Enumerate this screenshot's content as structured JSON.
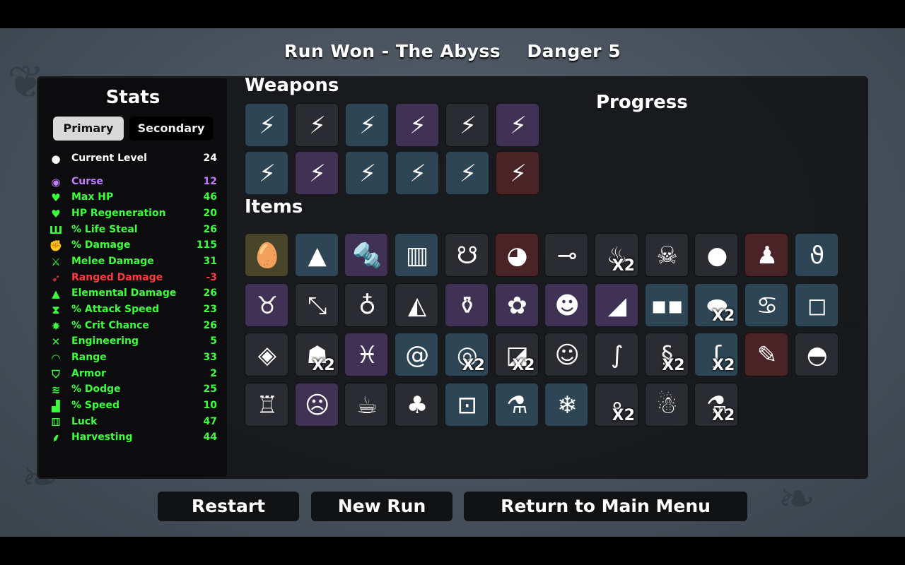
{
  "header": {
    "run_result": "Run Won - The Abyss",
    "danger": "Danger 5"
  },
  "stats": {
    "title": "Stats",
    "tabs": {
      "primary": "Primary",
      "secondary": "Secondary"
    },
    "rows": [
      {
        "label": "Current Level",
        "value": "24",
        "icon": "level-icon",
        "glyph": "●",
        "color": "#ffffff"
      },
      {
        "label": "Curse",
        "value": "12",
        "icon": "curse-icon",
        "glyph": "◉",
        "color": "#c77dff"
      },
      {
        "label": "Max HP",
        "value": "46",
        "icon": "heart-icon",
        "glyph": "♥",
        "color": "#3cff3c"
      },
      {
        "label": "HP Regeneration",
        "value": "20",
        "icon": "heart-plus-icon",
        "glyph": "♥",
        "color": "#3cff3c"
      },
      {
        "label": "% Life Steal",
        "value": "26",
        "icon": "life-steal-icon",
        "glyph": "Ш",
        "color": "#3cff3c"
      },
      {
        "label": "% Damage",
        "value": "115",
        "icon": "damage-icon",
        "glyph": "✊",
        "color": "#3cff3c"
      },
      {
        "label": "Melee Damage",
        "value": "31",
        "icon": "sword-icon",
        "glyph": "⚔",
        "color": "#3cff3c"
      },
      {
        "label": "Ranged Damage",
        "value": "-3",
        "icon": "ranged-icon",
        "glyph": "➶",
        "color": "#ff3b3b"
      },
      {
        "label": "Elemental Damage",
        "value": "26",
        "icon": "fire-icon",
        "glyph": "▲",
        "color": "#3cff3c"
      },
      {
        "label": "% Attack Speed",
        "value": "23",
        "icon": "hourglass-icon",
        "glyph": "⧗",
        "color": "#3cff3c"
      },
      {
        "label": "% Crit Chance",
        "value": "26",
        "icon": "crit-icon",
        "glyph": "✸",
        "color": "#3cff3c"
      },
      {
        "label": "Engineering",
        "value": "5",
        "icon": "wrench-icon",
        "glyph": "✕",
        "color": "#3cff3c"
      },
      {
        "label": "Range",
        "value": "33",
        "icon": "range-icon",
        "glyph": "◠",
        "color": "#3cff3c"
      },
      {
        "label": "Armor",
        "value": "2",
        "icon": "shield-icon",
        "glyph": "⛉",
        "color": "#3cff3c"
      },
      {
        "label": "% Dodge",
        "value": "25",
        "icon": "dodge-icon",
        "glyph": "≋",
        "color": "#3cff3c"
      },
      {
        "label": "% Speed",
        "value": "10",
        "icon": "boot-icon",
        "glyph": "▟",
        "color": "#3cff3c"
      },
      {
        "label": "Luck",
        "value": "47",
        "icon": "dice-icon",
        "glyph": "⚅",
        "color": "#3cff3c"
      },
      {
        "label": "Harvesting",
        "value": "44",
        "icon": "wheat-icon",
        "glyph": "⸙",
        "color": "#3cff3c"
      }
    ]
  },
  "weapons": {
    "title": "Weapons",
    "slots": [
      {
        "tier": "t2",
        "icon": "lightning-shiv-icon",
        "glyph": "⚡"
      },
      {
        "tier": "t1",
        "icon": "lightning-shiv-icon",
        "glyph": "⚡"
      },
      {
        "tier": "t2",
        "icon": "lightning-shiv-icon",
        "glyph": "⚡"
      },
      {
        "tier": "t3",
        "icon": "lightning-shiv-icon",
        "glyph": "⚡"
      },
      {
        "tier": "t1",
        "icon": "lightning-shiv-icon",
        "glyph": "⚡"
      },
      {
        "tier": "t3",
        "icon": "lightning-shiv-icon",
        "glyph": "⚡"
      },
      {
        "tier": "t2",
        "icon": "lightning-shiv-icon",
        "glyph": "⚡"
      },
      {
        "tier": "t3",
        "icon": "lightning-shiv-icon",
        "glyph": "⚡"
      },
      {
        "tier": "t2",
        "icon": "lightning-shiv-icon",
        "glyph": "⚡"
      },
      {
        "tier": "t2",
        "icon": "lightning-shiv-icon",
        "glyph": "⚡"
      },
      {
        "tier": "t2",
        "icon": "lightning-shiv-icon",
        "glyph": "⚡"
      },
      {
        "tier": "t4",
        "icon": "lightning-shiv-icon",
        "glyph": "⚡"
      }
    ]
  },
  "progress": {
    "title": "Progress"
  },
  "items": {
    "title": "Items",
    "slots": [
      {
        "tier": "t0",
        "icon": "egg-icon",
        "glyph": "🥚",
        "qty": ""
      },
      {
        "tier": "t2",
        "icon": "bullet-icon",
        "glyph": "▲",
        "qty": ""
      },
      {
        "tier": "t3",
        "icon": "screw-icon",
        "glyph": "🔩",
        "qty": ""
      },
      {
        "tier": "t2",
        "icon": "armor-plate-icon",
        "glyph": "▥",
        "qty": ""
      },
      {
        "tier": "t1",
        "icon": "alien-symbol-icon",
        "glyph": "☋",
        "qty": ""
      },
      {
        "tier": "t4",
        "icon": "alien-eye-icon",
        "glyph": "◕",
        "qty": ""
      },
      {
        "tier": "t1",
        "icon": "scope-icon",
        "glyph": "⊸",
        "qty": ""
      },
      {
        "tier": "t1",
        "icon": "worm-icon",
        "glyph": "♨",
        "qty": "X2"
      },
      {
        "tier": "t1",
        "icon": "skull-icon",
        "glyph": "☠",
        "qty": ""
      },
      {
        "tier": "t1",
        "icon": "boxing-glove-icon",
        "glyph": "●",
        "qty": ""
      },
      {
        "tier": "t4",
        "icon": "gnome-icon",
        "glyph": "♟",
        "qty": ""
      },
      {
        "tier": "t2",
        "icon": "tentacle-icon",
        "glyph": "ϑ",
        "qty": ""
      },
      {
        "tier": "t3",
        "icon": "demon-icon",
        "glyph": "♉",
        "qty": ""
      },
      {
        "tier": "t1",
        "icon": "syringe-icon",
        "glyph": "⤡",
        "qty": ""
      },
      {
        "tier": "t1",
        "icon": "sack-icon",
        "glyph": "♁",
        "qty": ""
      },
      {
        "tier": "t1",
        "icon": "cake-icon",
        "glyph": "◭",
        "qty": ""
      },
      {
        "tier": "t3",
        "icon": "bottle-icon",
        "glyph": "⚱",
        "qty": ""
      },
      {
        "tier": "t3",
        "icon": "brain-icon",
        "glyph": "✿",
        "qty": ""
      },
      {
        "tier": "t3",
        "icon": "robot-icon",
        "glyph": "☻",
        "qty": ""
      },
      {
        "tier": "t3",
        "icon": "fin-icon",
        "glyph": "◢",
        "qty": ""
      },
      {
        "tier": "t2",
        "icon": "glasses-icon",
        "glyph": "▪▪",
        "qty": ""
      },
      {
        "tier": "t2",
        "icon": "stone-icon",
        "glyph": "⬬",
        "qty": "X2"
      },
      {
        "tier": "t2",
        "icon": "octopus-icon",
        "glyph": "♋",
        "qty": ""
      },
      {
        "tier": "t2",
        "icon": "ice-cube-icon",
        "glyph": "◻",
        "qty": ""
      },
      {
        "tier": "t1",
        "icon": "mask-icon",
        "glyph": "◈",
        "qty": ""
      },
      {
        "tier": "t1",
        "icon": "ghost-icon",
        "glyph": "☗",
        "qty": "X2"
      },
      {
        "tier": "t3",
        "icon": "goldfish-icon",
        "glyph": "♓",
        "qty": ""
      },
      {
        "tier": "t2",
        "icon": "snail-icon",
        "glyph": "@",
        "qty": ""
      },
      {
        "tier": "t2",
        "icon": "magnet-icon",
        "glyph": "◎",
        "qty": "X2"
      },
      {
        "tier": "t1",
        "icon": "map-icon",
        "glyph": "◪",
        "qty": "X2"
      },
      {
        "tier": "t1",
        "icon": "mummy-icon",
        "glyph": "☺",
        "qty": ""
      },
      {
        "tier": "t1",
        "icon": "snake-red-icon",
        "glyph": "∫",
        "qty": ""
      },
      {
        "tier": "t1",
        "icon": "snake-green-icon",
        "glyph": "§",
        "qty": "X2"
      },
      {
        "tier": "t2",
        "icon": "larva-icon",
        "glyph": "ʃ",
        "qty": "X2"
      },
      {
        "tier": "t4",
        "icon": "torn-flesh-icon",
        "glyph": "✎",
        "qty": ""
      },
      {
        "tier": "t1",
        "icon": "helmet-icon",
        "glyph": "◓",
        "qty": ""
      },
      {
        "tier": "t1",
        "icon": "tooth-icon",
        "glyph": "♖",
        "qty": ""
      },
      {
        "tier": "t3",
        "icon": "zombie-icon",
        "glyph": "☹",
        "qty": ""
      },
      {
        "tier": "t1",
        "icon": "cup-icon",
        "glyph": "☕",
        "qty": ""
      },
      {
        "tier": "t1",
        "icon": "poison-bag-icon",
        "glyph": "♣",
        "qty": ""
      },
      {
        "tier": "t2",
        "icon": "jar-icon",
        "glyph": "⊡",
        "qty": ""
      },
      {
        "tier": "t2",
        "icon": "potion-icon",
        "glyph": "⚗",
        "qty": ""
      },
      {
        "tier": "t2",
        "icon": "snowball-icon",
        "glyph": "❄",
        "qty": ""
      },
      {
        "tier": "t1",
        "icon": "pebbles-icon",
        "glyph": "∘",
        "qty": "X2"
      },
      {
        "tier": "t1",
        "icon": "monkey-icon",
        "glyph": "☃",
        "qty": ""
      },
      {
        "tier": "t1",
        "icon": "cauldron-icon",
        "glyph": "⚗",
        "qty": "X2"
      }
    ]
  },
  "buttons": {
    "restart": "Restart",
    "new_run": "New Run",
    "main_menu": "Return to Main Menu"
  },
  "colors": {
    "tier_common": "#2a2c31",
    "tier_uncommon": "#2e4555",
    "tier_rare": "#3f3254",
    "tier_legendary": "#4a2326",
    "positive": "#3cff3c",
    "negative": "#ff3b3b",
    "curse": "#c77dff"
  }
}
